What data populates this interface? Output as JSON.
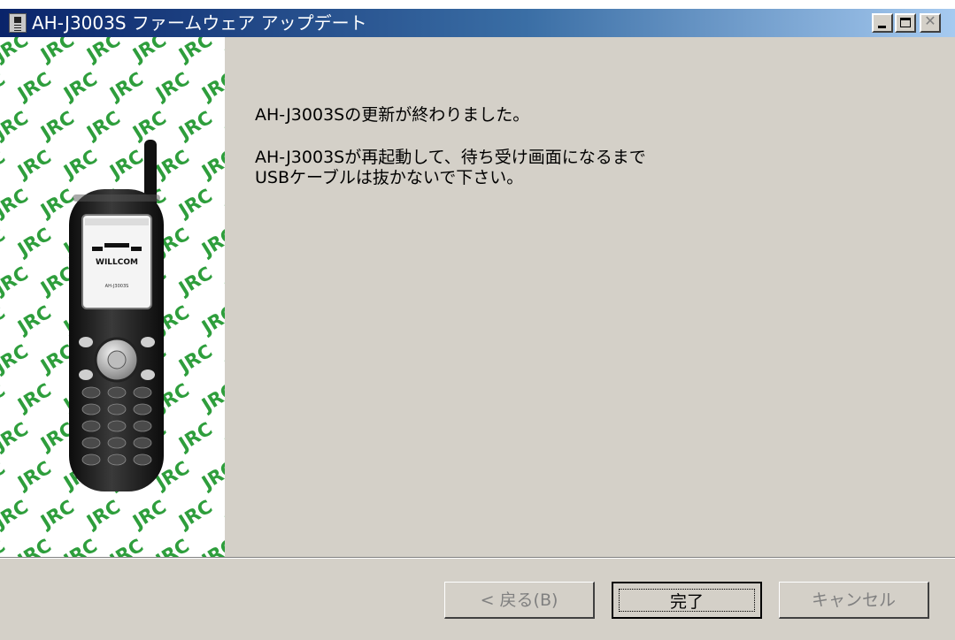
{
  "window": {
    "title": "AH-J3003S ファームウェア アップデート",
    "close_glyph": "✕"
  },
  "side_panel": {
    "pattern_text": "JRC",
    "pattern_color": "#2e9e3c",
    "phone_brand": "WILLCOM",
    "phone_model": "AH-J3003S"
  },
  "content": {
    "message_1": "AH-J3003Sの更新が終わりました。",
    "message_2_line_1": "AH-J3003Sが再起動して、待ち受け画面になるまで",
    "message_2_line_2": "USBケーブルは抜かないで下さい。"
  },
  "buttons": {
    "back_label": "< 戻る(B)",
    "finish_label": "完了",
    "cancel_label": "キャンセル"
  },
  "colors": {
    "title_gradient_start": "#0a246a",
    "title_gradient_end": "#a6caf0",
    "dialog_face": "#d4d0c8",
    "disabled_text": "#808080"
  }
}
